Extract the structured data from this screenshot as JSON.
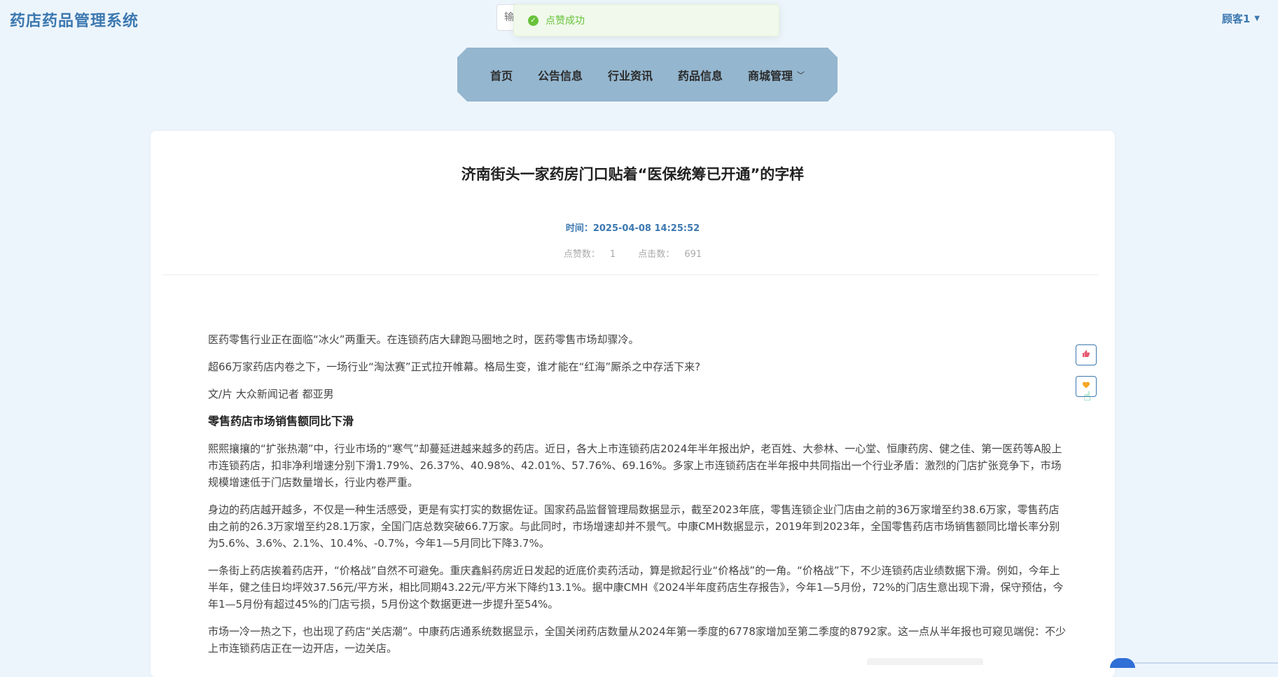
{
  "header": {
    "brand": "药店药品管理系统",
    "search_placeholder": "输入",
    "user_name": "顾客1"
  },
  "toast": {
    "message": "点赞成功",
    "color": "#67c23a"
  },
  "nav": {
    "items": [
      {
        "label": "首页"
      },
      {
        "label": "公告信息"
      },
      {
        "label": "行业资讯"
      },
      {
        "label": "药品信息"
      },
      {
        "label": "商城管理"
      }
    ]
  },
  "article": {
    "title": "济南街头一家药房门口贴着“医保统筹已开通”的字样",
    "time_label": "时间：",
    "time_value": "2025-04-08 14:25:52",
    "likes_label": "点赞数：",
    "likes_value": "1",
    "clicks_label": "点击数：",
    "clicks_value": "691",
    "paragraphs": [
      "医药零售行业正在面临“冰火”两重天。在连锁药店大肆跑马圈地之时，医药零售市场却骤冷。",
      "超66万家药店内卷之下，一场行业“淘汰赛”正式拉开帷幕。格局生变，谁才能在“红海”厮杀之中存活下来?",
      "文/片 大众新闻记者 都亚男",
      "零售药店市场销售额同比下滑",
      "熙熙攘攘的“扩张热潮”中，行业市场的“寒气”却蔓延进越来越多的药店。近日，各大上市连锁药店2024年半年报出炉，老百姓、大参林、一心堂、恒康药房、健之佳、第一医药等A股上市连锁药店，扣非净利增速分别下滑1.79%、26.37%、40.98%、42.01%、57.76%、69.16%。多家上市连锁药店在半年报中共同指出一个行业矛盾：激烈的门店扩张竞争下，市场规模增速低于门店数量增长，行业内卷严重。",
      "身边的药店越开越多，不仅是一种生活感受，更是有实打实的数据佐证。国家药品监督管理局数据显示，截至2023年底，零售连锁企业门店由之前的36万家增至约38.6万家，零售药店由之前的26.3万家增至约28.1万家，全国门店总数突破66.7万家。与此同时，市场增速却并不景气。中康CMH数据显示，2019年到2023年，全国零售药店市场销售额同比增长率分别为5.6%、3.6%、2.1%、10.4%、-0.7%，今年1—5月同比下降3.7%。",
      "一条街上药店挨着药店开，“价格战”自然不可避免。重庆鑫斛药房近日发起的近底价卖药活动，算是掀起行业“价格战”的一角。“价格战”下，不少连锁药店业绩数据下滑。例如，今年上半年，健之佳日均坪效37.56元/平方米，相比同期43.22元/平方米下降约13.1%。据中康CMH《2024半年度药店生存报告》，今年1—5月份，72%的门店生意出现下滑，保守预估，今年1—5月份有超过45%的门店亏损，5月份这个数据更进一步提升至54%。",
      "市场一冷一热之下，也出现了药店“关店潮”。中康药店通系统数据显示，全国关闭药店数量从2024年第一季度的6778家增加至第二季度的8792家。这一点从半年报也可窥见端倪：不少上市连锁药店正在一边开店，一边关店。"
    ]
  },
  "side_actions": {
    "like_icon": "thumbs-up-icon",
    "favorite_icon": "heart-icon"
  }
}
